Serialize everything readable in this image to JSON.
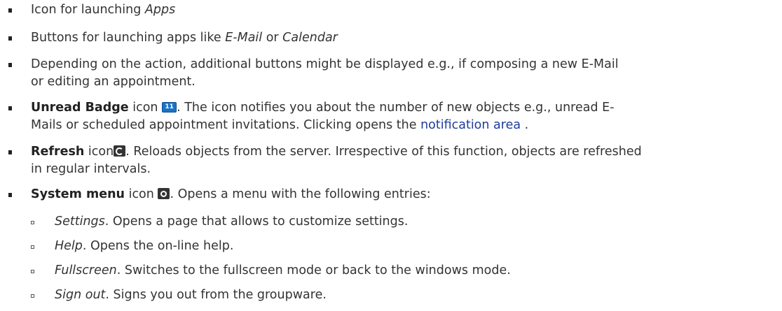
{
  "items": [
    {
      "pre": "Icon for launching ",
      "em": "Apps"
    },
    {
      "pre": "Buttons for launching apps like ",
      "em1": "E-Mail",
      "mid": " or ",
      "em2": "Calendar"
    },
    {
      "line1": "Depending on the action, additional buttons might be displayed e.g., if composing a new E-Mail",
      "line2": "or editing an appointment."
    },
    {
      "bold": "Unread Badge",
      "after_bold": " icon ",
      "badge_count": "11",
      "line1_rest": ". The icon notifies you about the number of new objects e.g., unread E-",
      "line2_pre": "Mails or scheduled appointment invitations. Clicking opens the ",
      "link": "notification area",
      "line2_post": " ."
    },
    {
      "bold": "Refresh",
      "after_bold": " icon",
      "line1_rest": ". Reloads objects from the server. Irrespective of this function, objects are refreshed",
      "line2": "in regular intervals."
    },
    {
      "bold": "System menu",
      "after_bold": " icon ",
      "line1_rest": ". Opens a menu with the following entries:"
    }
  ],
  "subitems": [
    {
      "em": "Settings",
      "rest": ". Opens a page that allows to customize settings."
    },
    {
      "em": "Help",
      "rest": ". Opens the on-line help."
    },
    {
      "em": "Fullscreen",
      "rest": ". Switches to the fullscreen mode or back to the windows mode."
    },
    {
      "em": "Sign out",
      "rest": ". Signs you out from the groupware."
    }
  ],
  "icons": {
    "badge": "unread-badge-icon",
    "refresh": "refresh-icon",
    "system": "gear-icon"
  }
}
